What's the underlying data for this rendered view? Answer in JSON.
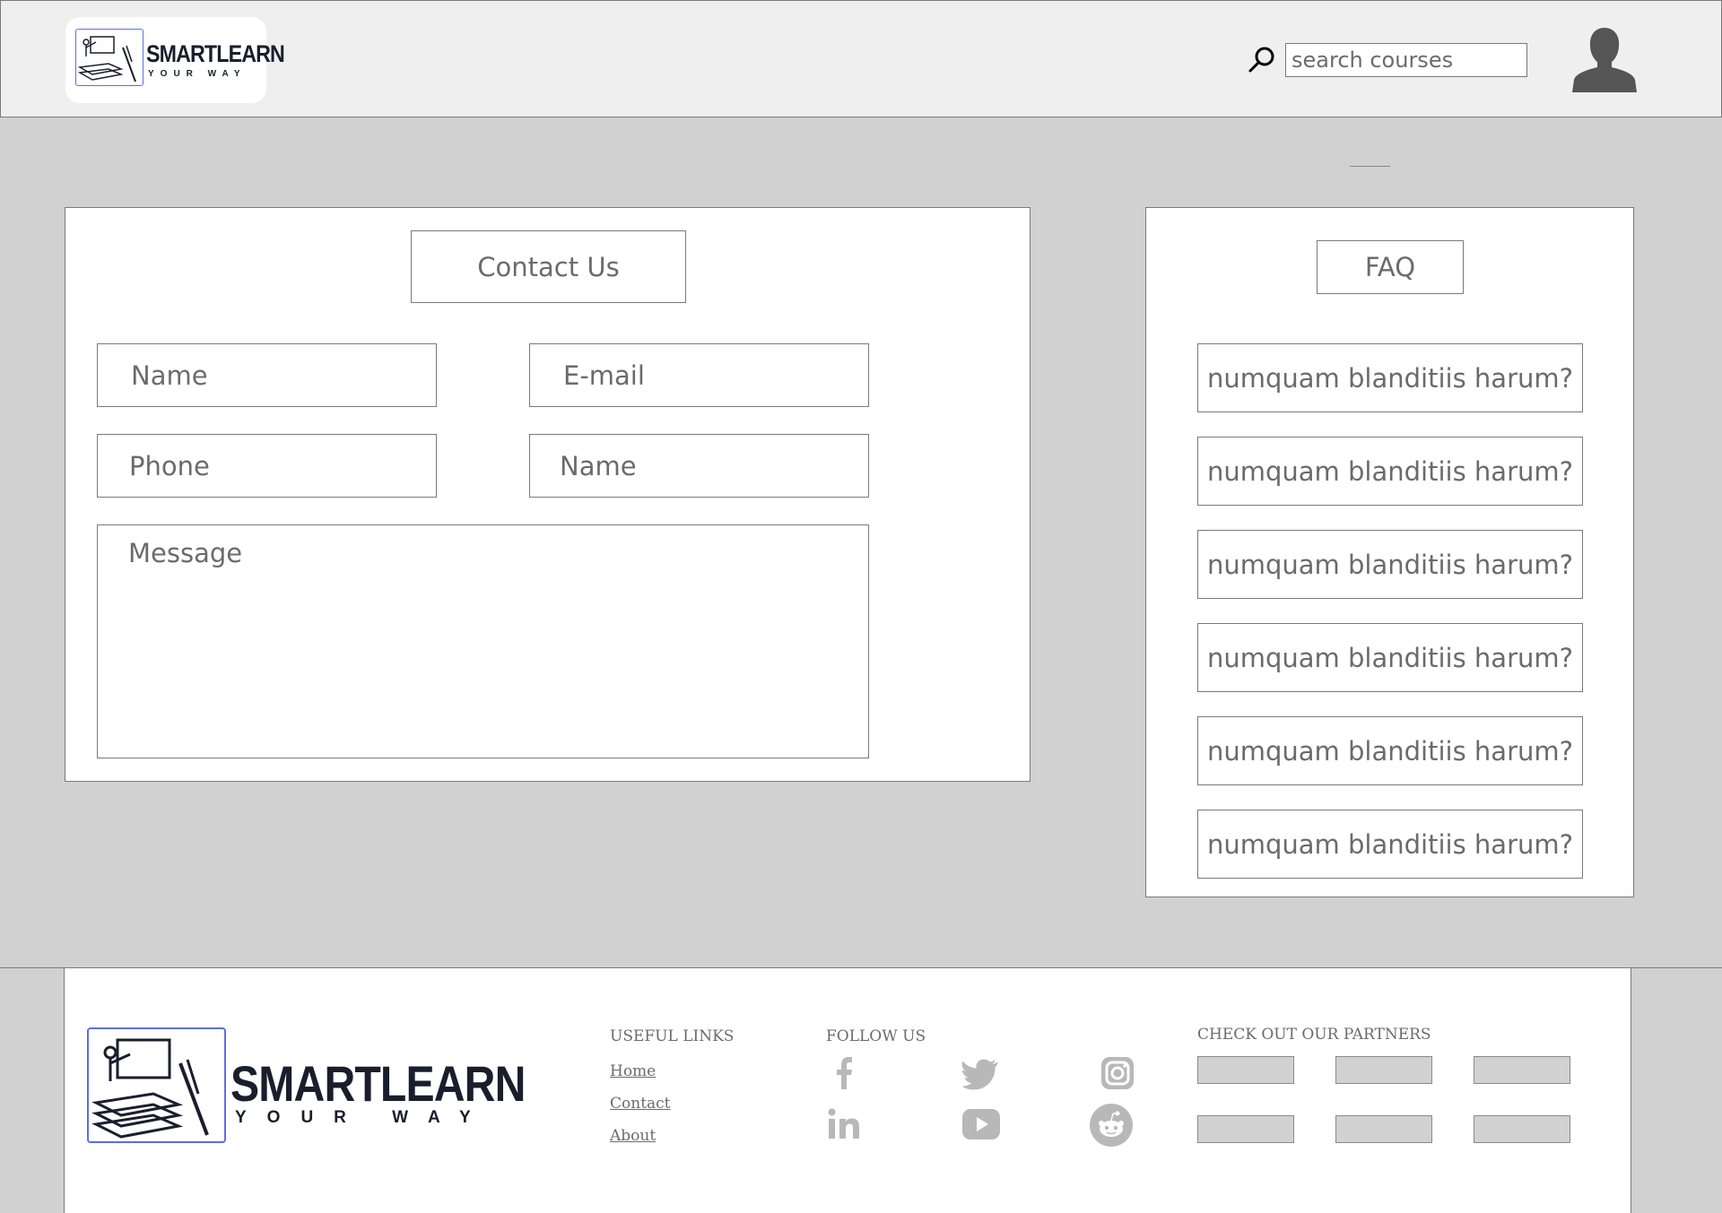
{
  "header": {
    "logo_word": "SMARTLEARN",
    "logo_sub": "YOUR WAY",
    "search_placeholder": "search courses"
  },
  "contact": {
    "title": "Contact Us",
    "fields": {
      "name": "Name",
      "email": "E-mail",
      "phone": "Phone",
      "name2": "Name",
      "message": "Message"
    }
  },
  "faq": {
    "title": "FAQ",
    "items": [
      "numquam blanditiis harum?",
      "numquam blanditiis harum?",
      "numquam blanditiis harum?",
      "numquam blanditiis harum?",
      "numquam blanditiis harum?",
      "numquam blanditiis harum?"
    ]
  },
  "footer": {
    "logo_word": "SMARTLEARN",
    "logo_sub": "YOUR WAY",
    "useful_links_heading": "USEFUL LINKS",
    "links": [
      "Home",
      "Contact",
      "About"
    ],
    "follow_heading": "FOLLOW US",
    "social_icons": [
      "facebook-icon",
      "twitter-icon",
      "instagram-icon",
      "linkedin-icon",
      "youtube-icon",
      "reddit-icon"
    ],
    "partners_heading": "CHECK OUT OUR PARTNERS"
  },
  "colors": {
    "page_bg": "#d1d1d1",
    "header_bg": "#efefef",
    "logo_border": "#5b6ee8",
    "text": "#6b6b6b",
    "icon_gray": "#b8b8b8"
  }
}
